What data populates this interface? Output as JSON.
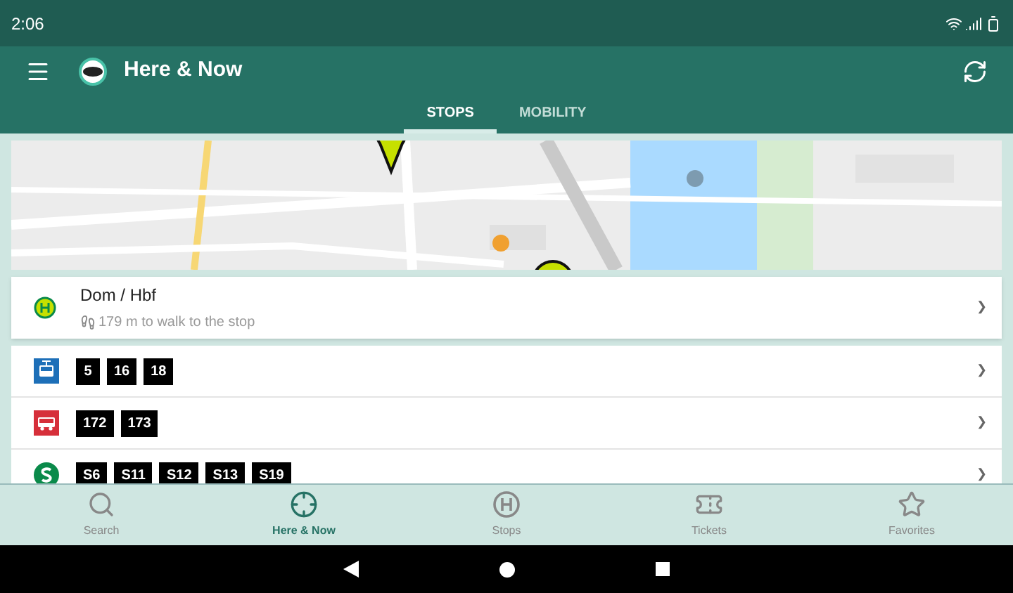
{
  "status_bar": {
    "time": "2:06"
  },
  "app_bar": {
    "title": "Here & Now"
  },
  "tabs": [
    {
      "label": "STOPS",
      "selected": true
    },
    {
      "label": "MOBILITY",
      "selected": false
    }
  ],
  "stop": {
    "name": "Dom / Hbf",
    "walk": "179 m to walk to the stop",
    "chevron": "❯"
  },
  "lines": [
    {
      "kind": "tram",
      "badges": [
        "5",
        "16",
        "18"
      ],
      "chevron": "❯"
    },
    {
      "kind": "bus",
      "badges": [
        "172",
        "173"
      ],
      "chevron": "❯"
    },
    {
      "kind": "sbahn",
      "badges": [
        "S6",
        "S11",
        "S12",
        "S13",
        "S19"
      ],
      "chevron": "❯"
    }
  ],
  "bottom_nav": [
    {
      "kind": "search",
      "label": "Search",
      "selected": false
    },
    {
      "kind": "here",
      "label": "Here & Now",
      "selected": true
    },
    {
      "kind": "stops",
      "label": "Stops",
      "selected": false
    },
    {
      "kind": "tickets",
      "label": "Tickets",
      "selected": false
    },
    {
      "kind": "favorites",
      "label": "Favorites",
      "selected": false
    }
  ]
}
